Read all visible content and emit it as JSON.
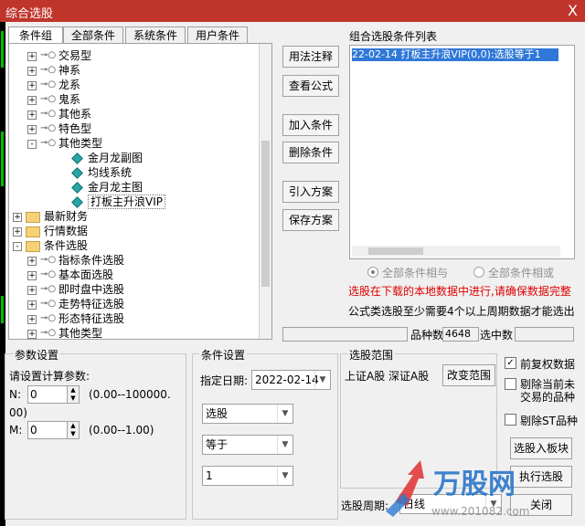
{
  "window": {
    "title": "综合选股",
    "close": "X"
  },
  "tabs": [
    "条件组",
    "全部条件",
    "系统条件",
    "用户条件"
  ],
  "tree": [
    {
      "label": "交易型",
      "level": 1,
      "kind": "key",
      "exp": "+"
    },
    {
      "label": "神系",
      "level": 1,
      "kind": "key",
      "exp": "+"
    },
    {
      "label": "龙系",
      "level": 1,
      "kind": "key",
      "exp": "+"
    },
    {
      "label": "鬼系",
      "level": 1,
      "kind": "key",
      "exp": "+"
    },
    {
      "label": "其他系",
      "level": 1,
      "kind": "key",
      "exp": "+"
    },
    {
      "label": "特色型",
      "level": 1,
      "kind": "key",
      "exp": "+"
    },
    {
      "label": "其他类型",
      "level": 1,
      "kind": "key",
      "exp": "-"
    },
    {
      "label": "金月龙副图",
      "level": 2,
      "kind": "leaf"
    },
    {
      "label": "均线系统",
      "level": 2,
      "kind": "leaf"
    },
    {
      "label": "金月龙主图",
      "level": 2,
      "kind": "leaf"
    },
    {
      "label": "打板主升浪VIP",
      "level": 2,
      "kind": "leaf",
      "selected": true
    },
    {
      "label": "最新财务",
      "level": 0,
      "kind": "folder",
      "exp": "+"
    },
    {
      "label": "行情数据",
      "level": 0,
      "kind": "folder",
      "exp": "+"
    },
    {
      "label": "条件选股",
      "level": 0,
      "kind": "folder",
      "exp": "-"
    },
    {
      "label": "指标条件选股",
      "level": 1,
      "kind": "key",
      "exp": "+"
    },
    {
      "label": "基本面选股",
      "level": 1,
      "kind": "key",
      "exp": "+"
    },
    {
      "label": "即时盘中选股",
      "level": 1,
      "kind": "key",
      "exp": "+"
    },
    {
      "label": "走势特征选股",
      "level": 1,
      "kind": "key",
      "exp": "+"
    },
    {
      "label": "形态特征选股",
      "level": 1,
      "kind": "key",
      "exp": "+"
    },
    {
      "label": "其他类型",
      "level": 1,
      "kind": "key",
      "exp": "+"
    }
  ],
  "buttons": {
    "usage": "用法注释",
    "view_formula": "查看公式",
    "add": "加入条件",
    "delete": "删除条件",
    "import": "引入方案",
    "save": "保存方案",
    "change_range": "改变范围",
    "to_block": "选股入板块",
    "execute": "执行选股",
    "close": "关闭"
  },
  "list": {
    "title": "组合选股条件列表",
    "items": [
      "22-02-14 打板主升浪VIP(0,0):选股等于1"
    ]
  },
  "radios": {
    "and": "全部条件相与",
    "or": "全部条件相或"
  },
  "notes": {
    "red": "选股在下载的本地数据中进行,请确保数据完整",
    "black": "公式类选股至少需要4个以上周期数据才能选出"
  },
  "counts": {
    "variety_label": "品种数",
    "variety_value": "4648",
    "selected_label": "选中数",
    "selected_value": ""
  },
  "params": {
    "title": "参数设置",
    "prompt": "请设置计算参数:",
    "n_label": "N:",
    "n_value": "0",
    "n_range": "(0.00--100000.",
    "n_range_cont": "00)",
    "m_label": "M:",
    "m_value": "0",
    "m_range": "(0.00--1.00)"
  },
  "conditions": {
    "title": "条件设置",
    "date_label": "指定日期:",
    "date_value": "2022-02-14",
    "combo1": "选股",
    "combo2": "等于",
    "combo3": "1"
  },
  "scope": {
    "title": "选股范围",
    "value": "上证A股  深证A股"
  },
  "checks": {
    "adjust": "前复权数据",
    "exclude_no_trade_1": "剔除当前未",
    "exclude_no_trade_2": "交易的品种",
    "exclude_st": "剔除ST品种"
  },
  "period": {
    "label": "选股周期:",
    "value": "日线"
  },
  "watermark": {
    "brand": "万股网",
    "url": "www.201082.com"
  }
}
